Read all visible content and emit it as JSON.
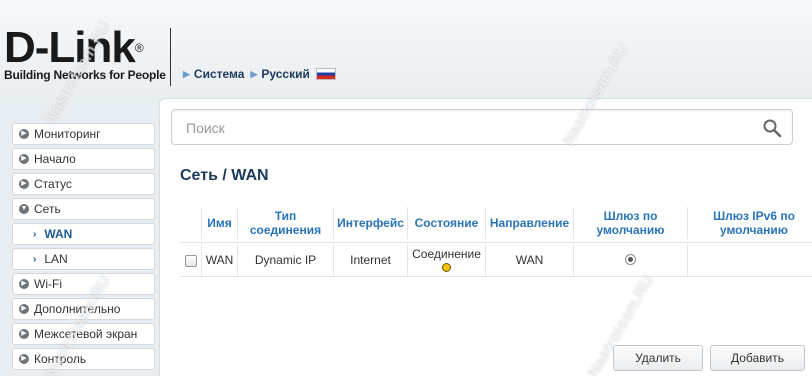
{
  "brand": {
    "logo_text": "D-Link",
    "tagline": "Building Networks for People",
    "reg": "®"
  },
  "breadcrumb": {
    "system": "Система",
    "language": "Русский"
  },
  "sidebar": {
    "items": [
      {
        "label": "Мониторинг",
        "type": "section"
      },
      {
        "label": "Начало",
        "type": "section"
      },
      {
        "label": "Статус",
        "type": "section"
      },
      {
        "label": "Сеть",
        "type": "section",
        "expanded": true
      },
      {
        "label": "WAN",
        "type": "sub",
        "active": true
      },
      {
        "label": "LAN",
        "type": "sub"
      },
      {
        "label": "Wi-Fi",
        "type": "section"
      },
      {
        "label": "Дополнительно",
        "type": "section"
      },
      {
        "label": "Межсетевой экран",
        "type": "section"
      },
      {
        "label": "Контроль",
        "type": "section"
      }
    ]
  },
  "search": {
    "placeholder": "Поиск"
  },
  "page": {
    "title": "Сеть /  WAN"
  },
  "table": {
    "headers": [
      "Имя",
      "Тип соединения",
      "Интерфейс",
      "Состояние",
      "Направление",
      "Шлюз по умолчанию",
      "Шлюз IPv6 по умолчанию"
    ],
    "rows": [
      {
        "name": "WAN",
        "type": "Dynamic IP",
        "interface": "Internet",
        "state": "Соединение",
        "direction": "WAN",
        "default_gw": true
      }
    ]
  },
  "buttons": {
    "delete": "Удалить",
    "add": "Добавить"
  },
  "watermark": "Nastroisam.RU",
  "colors": {
    "accent": "#2a75b9",
    "status": "#f2c200"
  }
}
